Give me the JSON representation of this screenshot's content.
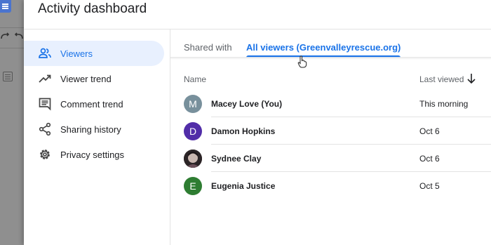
{
  "dialog": {
    "title": "Activity dashboard"
  },
  "nav": {
    "items": [
      {
        "label": "Viewers",
        "icon": "people-icon",
        "active": true
      },
      {
        "label": "Viewer trend",
        "icon": "trend-icon"
      },
      {
        "label": "Comment trend",
        "icon": "comment-icon"
      },
      {
        "label": "Sharing history",
        "icon": "share-icon"
      },
      {
        "label": "Privacy settings",
        "icon": "gear-icon"
      }
    ]
  },
  "tabs": [
    {
      "label": "Shared with"
    },
    {
      "label": "All viewers (Greenvalleyrescue.org)",
      "active": true
    }
  ],
  "table": {
    "col_name": "Name",
    "col_last_viewed": "Last viewed",
    "sort_icon": "arrow-down-icon",
    "rows": [
      {
        "initial": "M",
        "name": "Macey Love (You)",
        "last_viewed": "This morning",
        "avatar_color": "#78909c"
      },
      {
        "initial": "D",
        "name": "Damon Hopkins",
        "last_viewed": "Oct 6",
        "avatar_color": "#512da8"
      },
      {
        "initial": "",
        "name": "Sydnee Clay",
        "last_viewed": "Oct 6",
        "avatar_color": "#3a2a2a",
        "avatar_photo": true
      },
      {
        "initial": "E",
        "name": "Eugenia Justice",
        "last_viewed": "Oct 5",
        "avatar_color": "#2e7d32"
      }
    ]
  },
  "colors": {
    "accent": "#1a73e8",
    "active_bg": "#e8f0fe",
    "text": "#202124",
    "muted": "#5f6368"
  }
}
